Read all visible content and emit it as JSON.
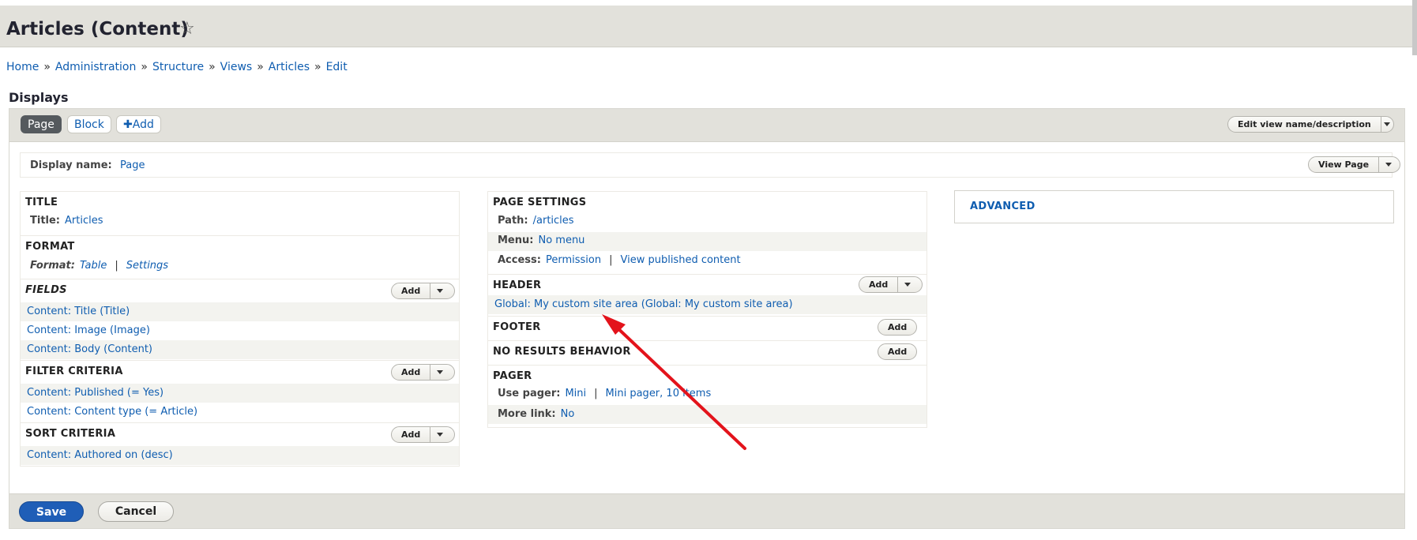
{
  "page": {
    "title": "Articles (Content)",
    "star_icon": "star-outline-icon",
    "breadcrumb": [
      "Home",
      "Administration",
      "Structure",
      "Views",
      "Articles",
      "Edit"
    ],
    "breadcrumb_sep": "»"
  },
  "displays": {
    "heading": "Displays",
    "tabs": {
      "page": "Page",
      "block": "Block",
      "add": "Add",
      "add_icon": "plus-icon"
    },
    "edit_view_name": "Edit view name/description"
  },
  "display_name": {
    "label": "Display name:",
    "value": "Page",
    "view_page": "View Page"
  },
  "left": {
    "title_section": "TITLE",
    "title_label": "Title:",
    "title_value": "Articles",
    "format_section": "FORMAT",
    "format_label": "Format:",
    "format_value": "Table",
    "format_settings": "Settings",
    "fields_section": "FIELDS",
    "fields_add": "Add",
    "fields": [
      "Content: Title (Title)",
      "Content: Image (Image)",
      "Content: Body (Content)"
    ],
    "filter_section": "FILTER CRITERIA",
    "filter_add": "Add",
    "filters": [
      "Content: Published (= Yes)",
      "Content: Content type (= Article)"
    ],
    "sort_section": "SORT CRITERIA",
    "sort_add": "Add",
    "sorts": [
      "Content: Authored on (desc)"
    ]
  },
  "middle": {
    "page_settings": "PAGE SETTINGS",
    "path_label": "Path:",
    "path_value": "/articles",
    "menu_label": "Menu:",
    "menu_value": "No menu",
    "access_label": "Access:",
    "access_value": "Permission",
    "access_detail": "View published content",
    "header_section": "HEADER",
    "header_add": "Add",
    "header_item": "Global: My custom site area (Global: My custom site area)",
    "footer_section": "FOOTER",
    "footer_add": "Add",
    "noresults_section": "NO RESULTS BEHAVIOR",
    "noresults_add": "Add",
    "pager_section": "PAGER",
    "use_pager_label": "Use pager:",
    "use_pager_value": "Mini",
    "use_pager_detail": "Mini pager, 10 items",
    "more_link_label": "More link:",
    "more_link_value": "No"
  },
  "right": {
    "advanced": "ADVANCED"
  },
  "actions": {
    "save": "Save",
    "cancel": "Cancel"
  },
  "annotation": {
    "arrow_color": "#e3131b"
  },
  "colors": {
    "link": "#0f5db0",
    "band": "#e2e1db",
    "primary": "#1f5eb7"
  }
}
